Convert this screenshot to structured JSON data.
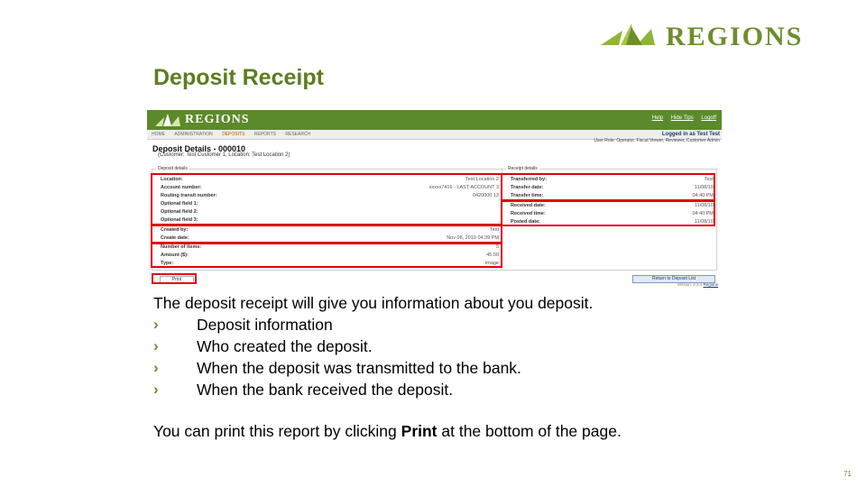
{
  "brand": {
    "name": "Regions",
    "wordmark": "REGIONS",
    "color": "#6e8d2e"
  },
  "slide": {
    "title": "Deposit Receipt",
    "page_number": "71"
  },
  "screenshot": {
    "logo_text": "REGIONS",
    "top_links": [
      "Help",
      "Hide Tips",
      "Logoff"
    ],
    "nav_tabs": [
      "HOME",
      "ADMINISTRATION",
      "DEPOSITS",
      "REPORTS",
      "RESEARCH"
    ],
    "active_tab": "DEPOSITS",
    "user_line1": "Logged in as Test Test",
    "user_line2": "User Role: Operator, Fiscal Viewer, Reviewer, Customer Admin",
    "heading": "Deposit Details - 000010",
    "subheading": "(Customer: Test Customer 1, Location: Test Location 2)",
    "deposit_panel_title": "Deposit details",
    "receipt_panel_title": "Receipt details",
    "deposit_rows": [
      {
        "label": "Location:",
        "value": "Test Location 2"
      },
      {
        "label": "Account number:",
        "value": "xxxxx7416 - LAST ACCOUNT 3"
      },
      {
        "label": "Routing transit number:",
        "value": "0420000 13"
      },
      {
        "label": "Optional field 1:",
        "value": ""
      },
      {
        "label": "Optional field 2:",
        "value": ""
      },
      {
        "label": "Optional field 3:",
        "value": ""
      },
      {
        "label": "Created by:",
        "value": "Test"
      },
      {
        "label": "Create date:",
        "value": "Nov 08, 2010 04:39 PM"
      },
      {
        "label": "Number of items:",
        "value": "5"
      },
      {
        "label": "Amount ($):",
        "value": "45.00"
      },
      {
        "label": "Type:",
        "value": "Image"
      }
    ],
    "receipt_rows": [
      {
        "label": "Transferred by:",
        "value": "Test"
      },
      {
        "label": "Transfer date:",
        "value": "11/08/10"
      },
      {
        "label": "Transfer time:",
        "value": "04:40 PM"
      },
      {
        "label": "Received date:",
        "value": "11/08/10"
      },
      {
        "label": "Received time:",
        "value": "04:40 PM"
      },
      {
        "label": "Posted date:",
        "value": "11/08/10"
      }
    ],
    "print_button": "Print",
    "return_button": "Return to Deposit List",
    "version_text": "Version: 2.3.4",
    "version_link": "Regions"
  },
  "body": {
    "intro": "The deposit receipt will give you information about you deposit.",
    "bullet_glyph": "›",
    "bullets": [
      "Deposit information",
      "Who created the deposit.",
      "When the deposit was transmitted to the bank.",
      "When the bank received the deposit."
    ],
    "footer_pre": "You can print this report by clicking ",
    "footer_bold": "Print",
    "footer_post": " at the bottom of the page."
  }
}
